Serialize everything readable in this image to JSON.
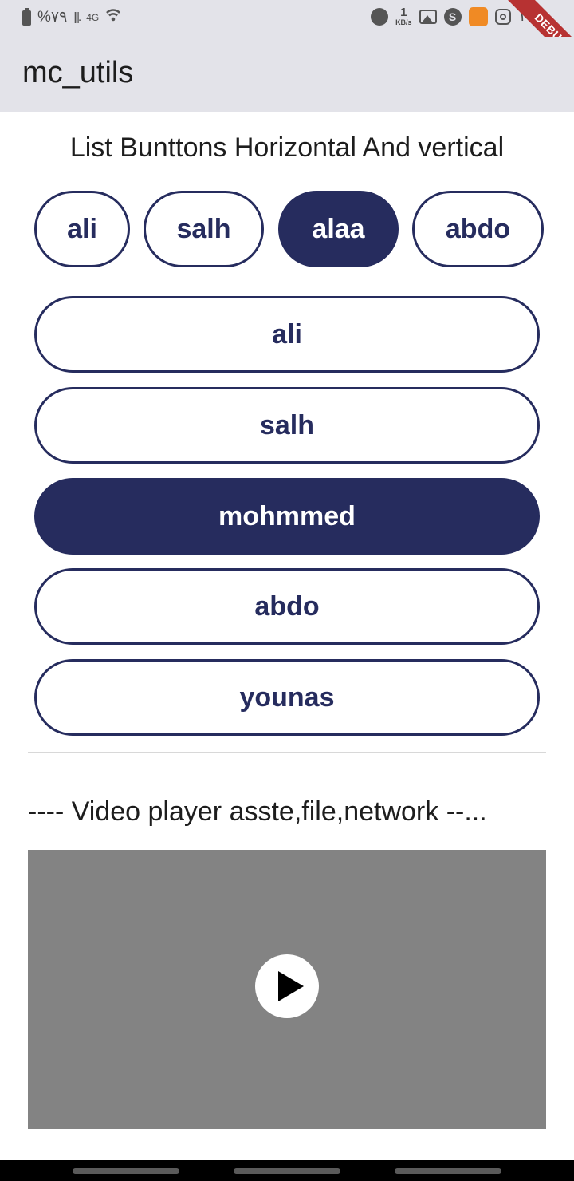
{
  "status_bar": {
    "battery_text": "%٧٩",
    "signal_text": "|||.",
    "network_label": "4G",
    "speed_value": "1",
    "speed_unit": "KB/s",
    "vpn_glyph": "S",
    "time": "١١",
    "icons": [
      "battery-icon",
      "signal-icon",
      "network-icon",
      "wifi-icon",
      "bubble-icon",
      "image-icon",
      "s-app-icon",
      "shopping-bag-icon",
      "instagram-icon"
    ]
  },
  "debug_banner": "DEBUG",
  "app_bar": {
    "title": "mc_utils"
  },
  "horizontal_section": {
    "title": "List Bunttons Horizontal And vertical",
    "buttons": [
      {
        "label": "ali",
        "selected": false
      },
      {
        "label": "salh",
        "selected": false
      },
      {
        "label": "alaa",
        "selected": true
      },
      {
        "label": "abdo",
        "selected": false
      }
    ]
  },
  "vertical_section": {
    "buttons": [
      {
        "label": "ali",
        "selected": false
      },
      {
        "label": "salh",
        "selected": false
      },
      {
        "label": "mohmmed",
        "selected": true
      },
      {
        "label": "abdo",
        "selected": false
      },
      {
        "label": "younas",
        "selected": false
      }
    ]
  },
  "video_section": {
    "title": "---- Video player asste,file,network --..."
  },
  "colors": {
    "accent": "#262c5e",
    "app_bar": "#e3e3e9",
    "video_background": "#838383",
    "debug_banner": "#b73232"
  }
}
